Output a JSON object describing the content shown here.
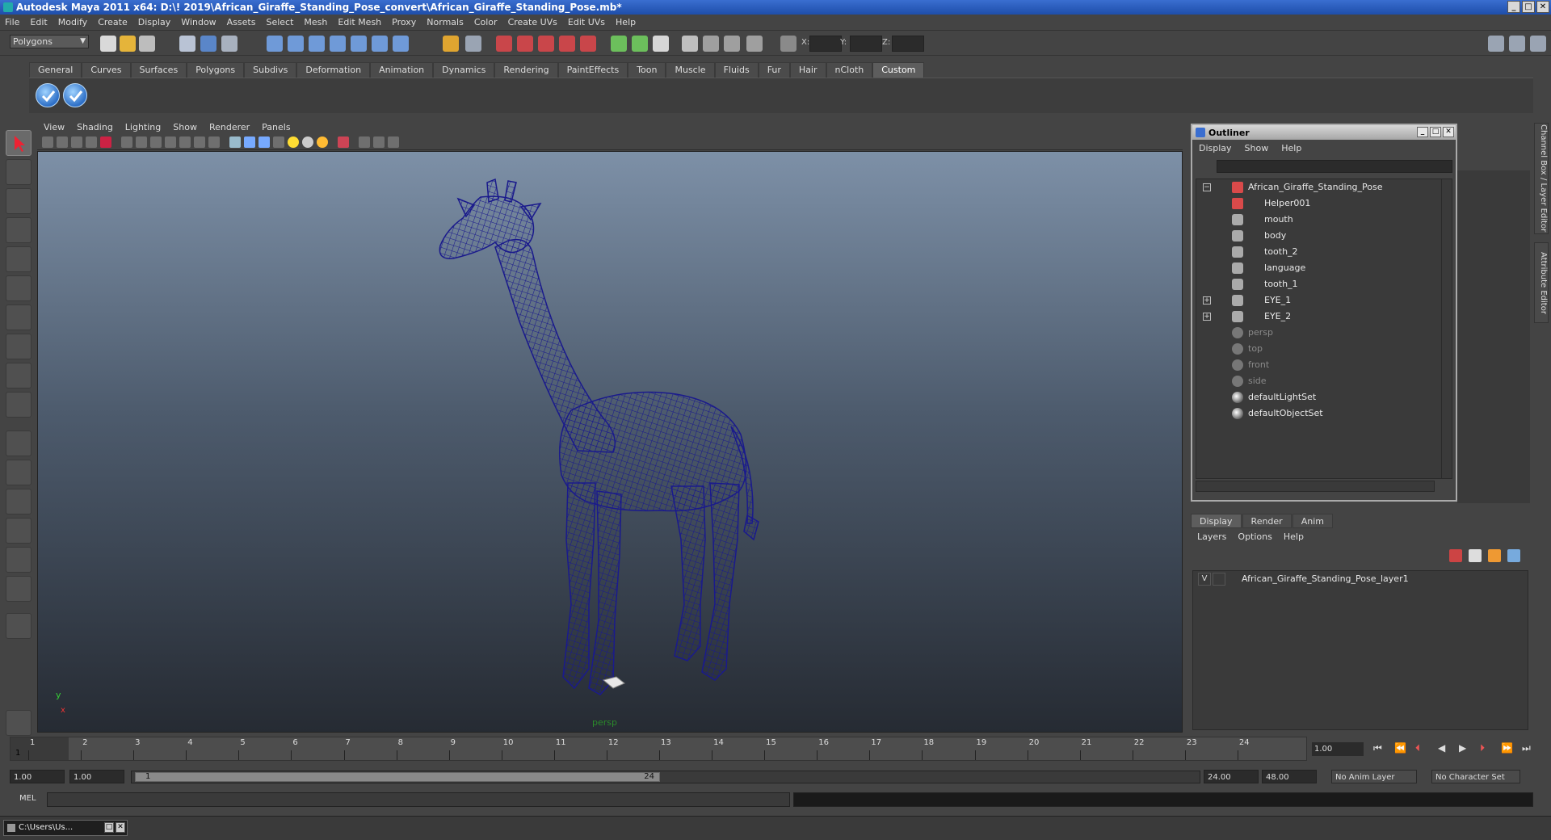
{
  "window": {
    "title": "Autodesk Maya 2011 x64: D:\\! 2019\\African_Giraffe_Standing_Pose_convert\\African_Giraffe_Standing_Pose.mb*",
    "min": "_",
    "max": "□",
    "close": "✕"
  },
  "menubar": [
    "File",
    "Edit",
    "Modify",
    "Create",
    "Display",
    "Window",
    "Assets",
    "Select",
    "Mesh",
    "Edit Mesh",
    "Proxy",
    "Normals",
    "Color",
    "Create UVs",
    "Edit UVs",
    "Help"
  ],
  "statusline": {
    "mode": "Polygons",
    "x_label": "X:",
    "y_label": "Y:",
    "z_label": "Z:"
  },
  "shelf": {
    "tabs": [
      "General",
      "Curves",
      "Surfaces",
      "Polygons",
      "Subdivs",
      "Deformation",
      "Animation",
      "Dynamics",
      "Rendering",
      "PaintEffects",
      "Toon",
      "Muscle",
      "Fluids",
      "Fur",
      "Hair",
      "nCloth",
      "Custom"
    ],
    "active_tab": "Custom"
  },
  "viewport": {
    "menu": [
      "View",
      "Shading",
      "Lighting",
      "Show",
      "Renderer",
      "Panels"
    ],
    "camera_label": "persp",
    "axis_y": "y",
    "axis_x": "x",
    "wire_color": "#1a1a8c"
  },
  "outliner": {
    "title": "Outliner",
    "menu": [
      "Display",
      "Show",
      "Help"
    ],
    "items": [
      {
        "label": "African_Giraffe_Standing_Pose",
        "icon": "transform-icon",
        "dim": false
      },
      {
        "label": "Helper001",
        "icon": "transform-icon",
        "dim": false
      },
      {
        "label": "mouth",
        "icon": "mesh-icon",
        "dim": false
      },
      {
        "label": "body",
        "icon": "mesh-icon",
        "dim": false
      },
      {
        "label": "tooth_2",
        "icon": "mesh-icon",
        "dim": false
      },
      {
        "label": "language",
        "icon": "mesh-icon",
        "dim": false
      },
      {
        "label": "tooth_1",
        "icon": "mesh-icon",
        "dim": false
      },
      {
        "label": "EYE_1",
        "icon": "mesh-icon",
        "dim": false
      },
      {
        "label": "EYE_2",
        "icon": "mesh-icon",
        "dim": false
      },
      {
        "label": "persp",
        "icon": "camera-icon",
        "dim": true
      },
      {
        "label": "top",
        "icon": "camera-icon",
        "dim": true
      },
      {
        "label": "front",
        "icon": "camera-icon",
        "dim": true
      },
      {
        "label": "side",
        "icon": "camera-icon",
        "dim": true
      },
      {
        "label": "defaultLightSet",
        "icon": "set-icon",
        "dim": false
      },
      {
        "label": "defaultObjectSet",
        "icon": "set-icon",
        "dim": false
      }
    ]
  },
  "side_tabs": {
    "channel_box": "Channel Box / Layer Editor",
    "attribute_editor": "Attribute Editor"
  },
  "layer_editor": {
    "tabs": [
      "Display",
      "Render",
      "Anim"
    ],
    "menu": [
      "Layers",
      "Options",
      "Help"
    ],
    "layers": [
      {
        "visible": "V",
        "name": "African_Giraffe_Standing_Pose_layer1"
      }
    ]
  },
  "timeline": {
    "ticks": [
      "1",
      "2",
      "3",
      "4",
      "5",
      "6",
      "7",
      "8",
      "9",
      "10",
      "11",
      "12",
      "13",
      "14",
      "15",
      "16",
      "17",
      "18",
      "19",
      "20",
      "21",
      "22",
      "23",
      "24"
    ],
    "current_frame": "1",
    "current_time": "1.00"
  },
  "range": {
    "start": "1.00",
    "start_inner": "1.00",
    "handle_start": "1",
    "handle_end": "24",
    "end_inner": "24.00",
    "end": "48.00",
    "anim_layer": "No Anim Layer",
    "character_set": "No Character Set"
  },
  "cmdline": {
    "label": "MEL"
  },
  "taskbar": {
    "item": "C:\\Users\\Us..."
  }
}
